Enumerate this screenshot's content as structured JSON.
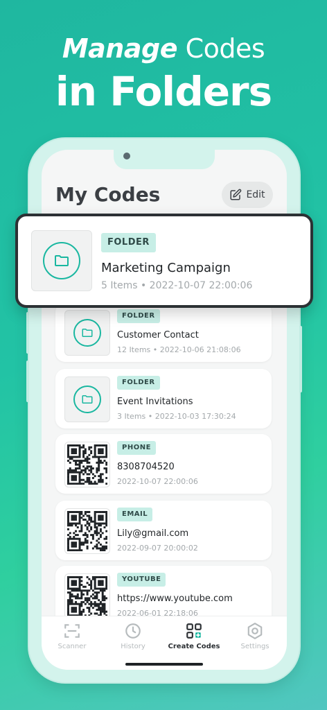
{
  "headline": {
    "line1_italic": "Manage",
    "line1_rest": " Codes",
    "line2": "in Folders"
  },
  "screen": {
    "title": "My Codes",
    "edit_label": "Edit"
  },
  "highlight": {
    "type": "FOLDER",
    "title": "Marketing Campaign",
    "subtitle": "5 Items • 2022-10-07 22:00:06"
  },
  "items": [
    {
      "type": "FOLDER",
      "title": "Customer Contact",
      "subtitle": "12 Items • 2022-10-06 21:08:06",
      "icon": "folder-icon"
    },
    {
      "type": "FOLDER",
      "title": "Event Invitations",
      "subtitle": "3 Items • 2022-10-03 17:30:24",
      "icon": "folder-icon"
    },
    {
      "type": "PHONE",
      "title": "8308704520",
      "subtitle": "2022-10-07 22:00:06",
      "icon": "qr-code-icon"
    },
    {
      "type": "EMAIL",
      "title": "Lily@gmail.com",
      "subtitle": "2022-09-07 20:00:02",
      "icon": "qr-code-icon"
    },
    {
      "type": "YOUTUBE",
      "title": "https://www.youtube.com",
      "subtitle": "2022-06-01 22:18:06",
      "icon": "qr-code-icon"
    }
  ],
  "tabs": [
    {
      "label": "Scanner",
      "icon": "scan-frame-icon",
      "active": false
    },
    {
      "label": "History",
      "icon": "clock-icon",
      "active": false
    },
    {
      "label": "Create Codes",
      "icon": "qr-grid-icon",
      "active": true
    },
    {
      "label": "Settings",
      "icon": "hexagon-gear-icon",
      "active": false
    }
  ],
  "colors": {
    "accent": "#19B7A0",
    "badge_bg": "#C7EEE6",
    "background_gradient_start": "#1FB7A0",
    "background_gradient_end": "#52C6C0"
  }
}
